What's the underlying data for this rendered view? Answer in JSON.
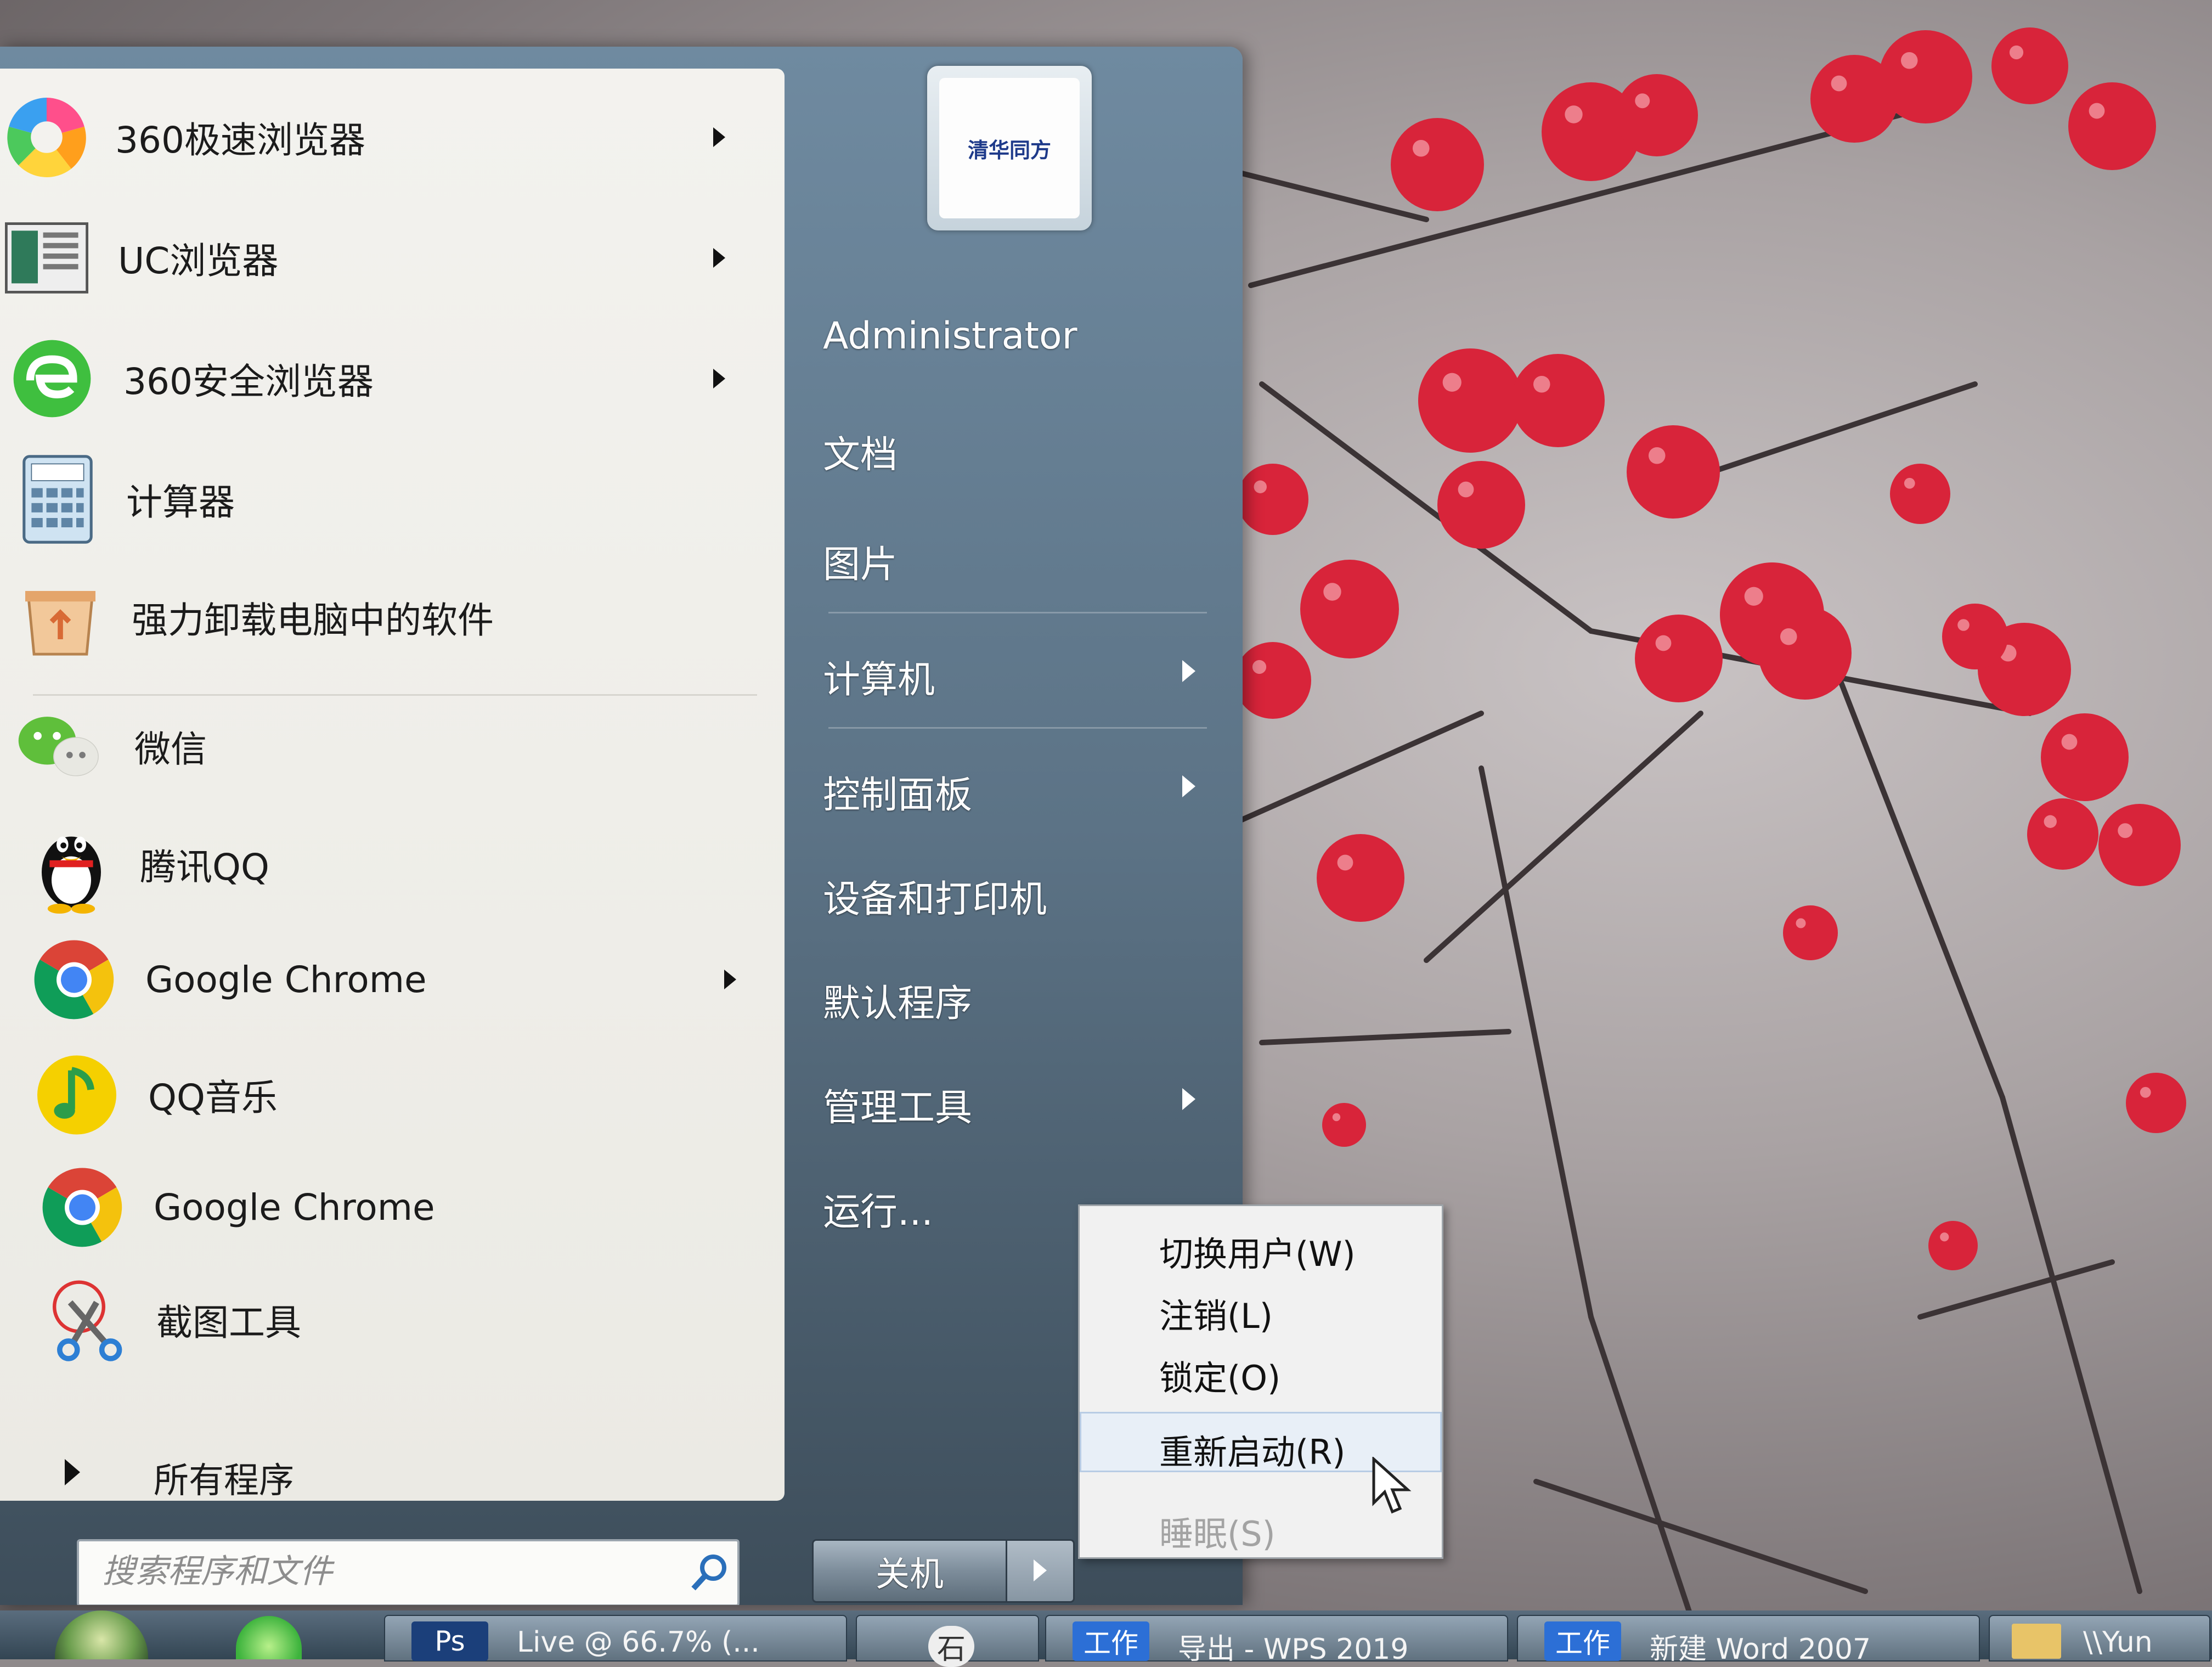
{
  "left_menu": {
    "pinned": [
      {
        "label": "360极速浏览器",
        "icon": "360-speed-browser-icon",
        "has_submenu": true
      },
      {
        "label": "UC浏览器",
        "icon": "uc-browser-icon",
        "has_submenu": true
      },
      {
        "label": "360安全浏览器",
        "icon": "360-secure-browser-icon",
        "has_submenu": true
      },
      {
        "label": "计算器",
        "icon": "calculator-icon",
        "has_submenu": false
      },
      {
        "label": "强力卸载电脑中的软件",
        "icon": "uninstall-icon",
        "has_submenu": false
      }
    ],
    "recent": [
      {
        "label": "微信",
        "icon": "wechat-icon",
        "has_submenu": false
      },
      {
        "label": "腾讯QQ",
        "icon": "qq-penguin-icon",
        "has_submenu": false
      },
      {
        "label": "Google Chrome",
        "icon": "chrome-icon",
        "has_submenu": true
      },
      {
        "label": "QQ音乐",
        "icon": "qq-music-icon",
        "has_submenu": false
      },
      {
        "label": "Google Chrome",
        "icon": "chrome-icon",
        "has_submenu": false
      },
      {
        "label": "截图工具",
        "icon": "snipping-tool-icon",
        "has_submenu": false
      }
    ],
    "all_programs_label": "所有程序",
    "search_placeholder": "搜索程序和文件"
  },
  "right_menu": {
    "avatar_text": "清华同方",
    "items": [
      {
        "label": "Administrator",
        "has_submenu": false
      },
      {
        "label": "文档",
        "has_submenu": false
      },
      {
        "label": "图片",
        "has_submenu": false
      },
      {
        "label": "计算机",
        "has_submenu": true
      },
      {
        "label": "控制面板",
        "has_submenu": true
      },
      {
        "label": "设备和打印机",
        "has_submenu": false
      },
      {
        "label": "默认程序",
        "has_submenu": false
      },
      {
        "label": "管理工具",
        "has_submenu": true
      },
      {
        "label": "运行...",
        "has_submenu": false
      }
    ],
    "shutdown_label": "关机"
  },
  "context_menu": {
    "items": [
      {
        "label": "切换用户(W)",
        "state": "normal"
      },
      {
        "label": "注销(L)",
        "state": "normal"
      },
      {
        "label": "锁定(O)",
        "state": "normal"
      },
      {
        "label": "重新启动(R)",
        "state": "hover"
      },
      {
        "label": "睡眠(S)",
        "state": "disabled"
      }
    ]
  },
  "taskbar": {
    "buttons": [
      {
        "badge": "Ps",
        "label": "Live @ 66.7% (..."
      },
      {
        "badge": "",
        "label": "石"
      },
      {
        "badge": "工作",
        "label": "导出 - WPS 2019"
      },
      {
        "badge": "工作",
        "label": "新建 Word 2007"
      },
      {
        "badge": "",
        "label": "\\\\Yun"
      }
    ]
  },
  "colors": {
    "menu_left_bg": "#efeee9",
    "menu_right_bg": "#5c7386",
    "context_bg": "#f1f1f1",
    "berry": "#d8243a"
  }
}
